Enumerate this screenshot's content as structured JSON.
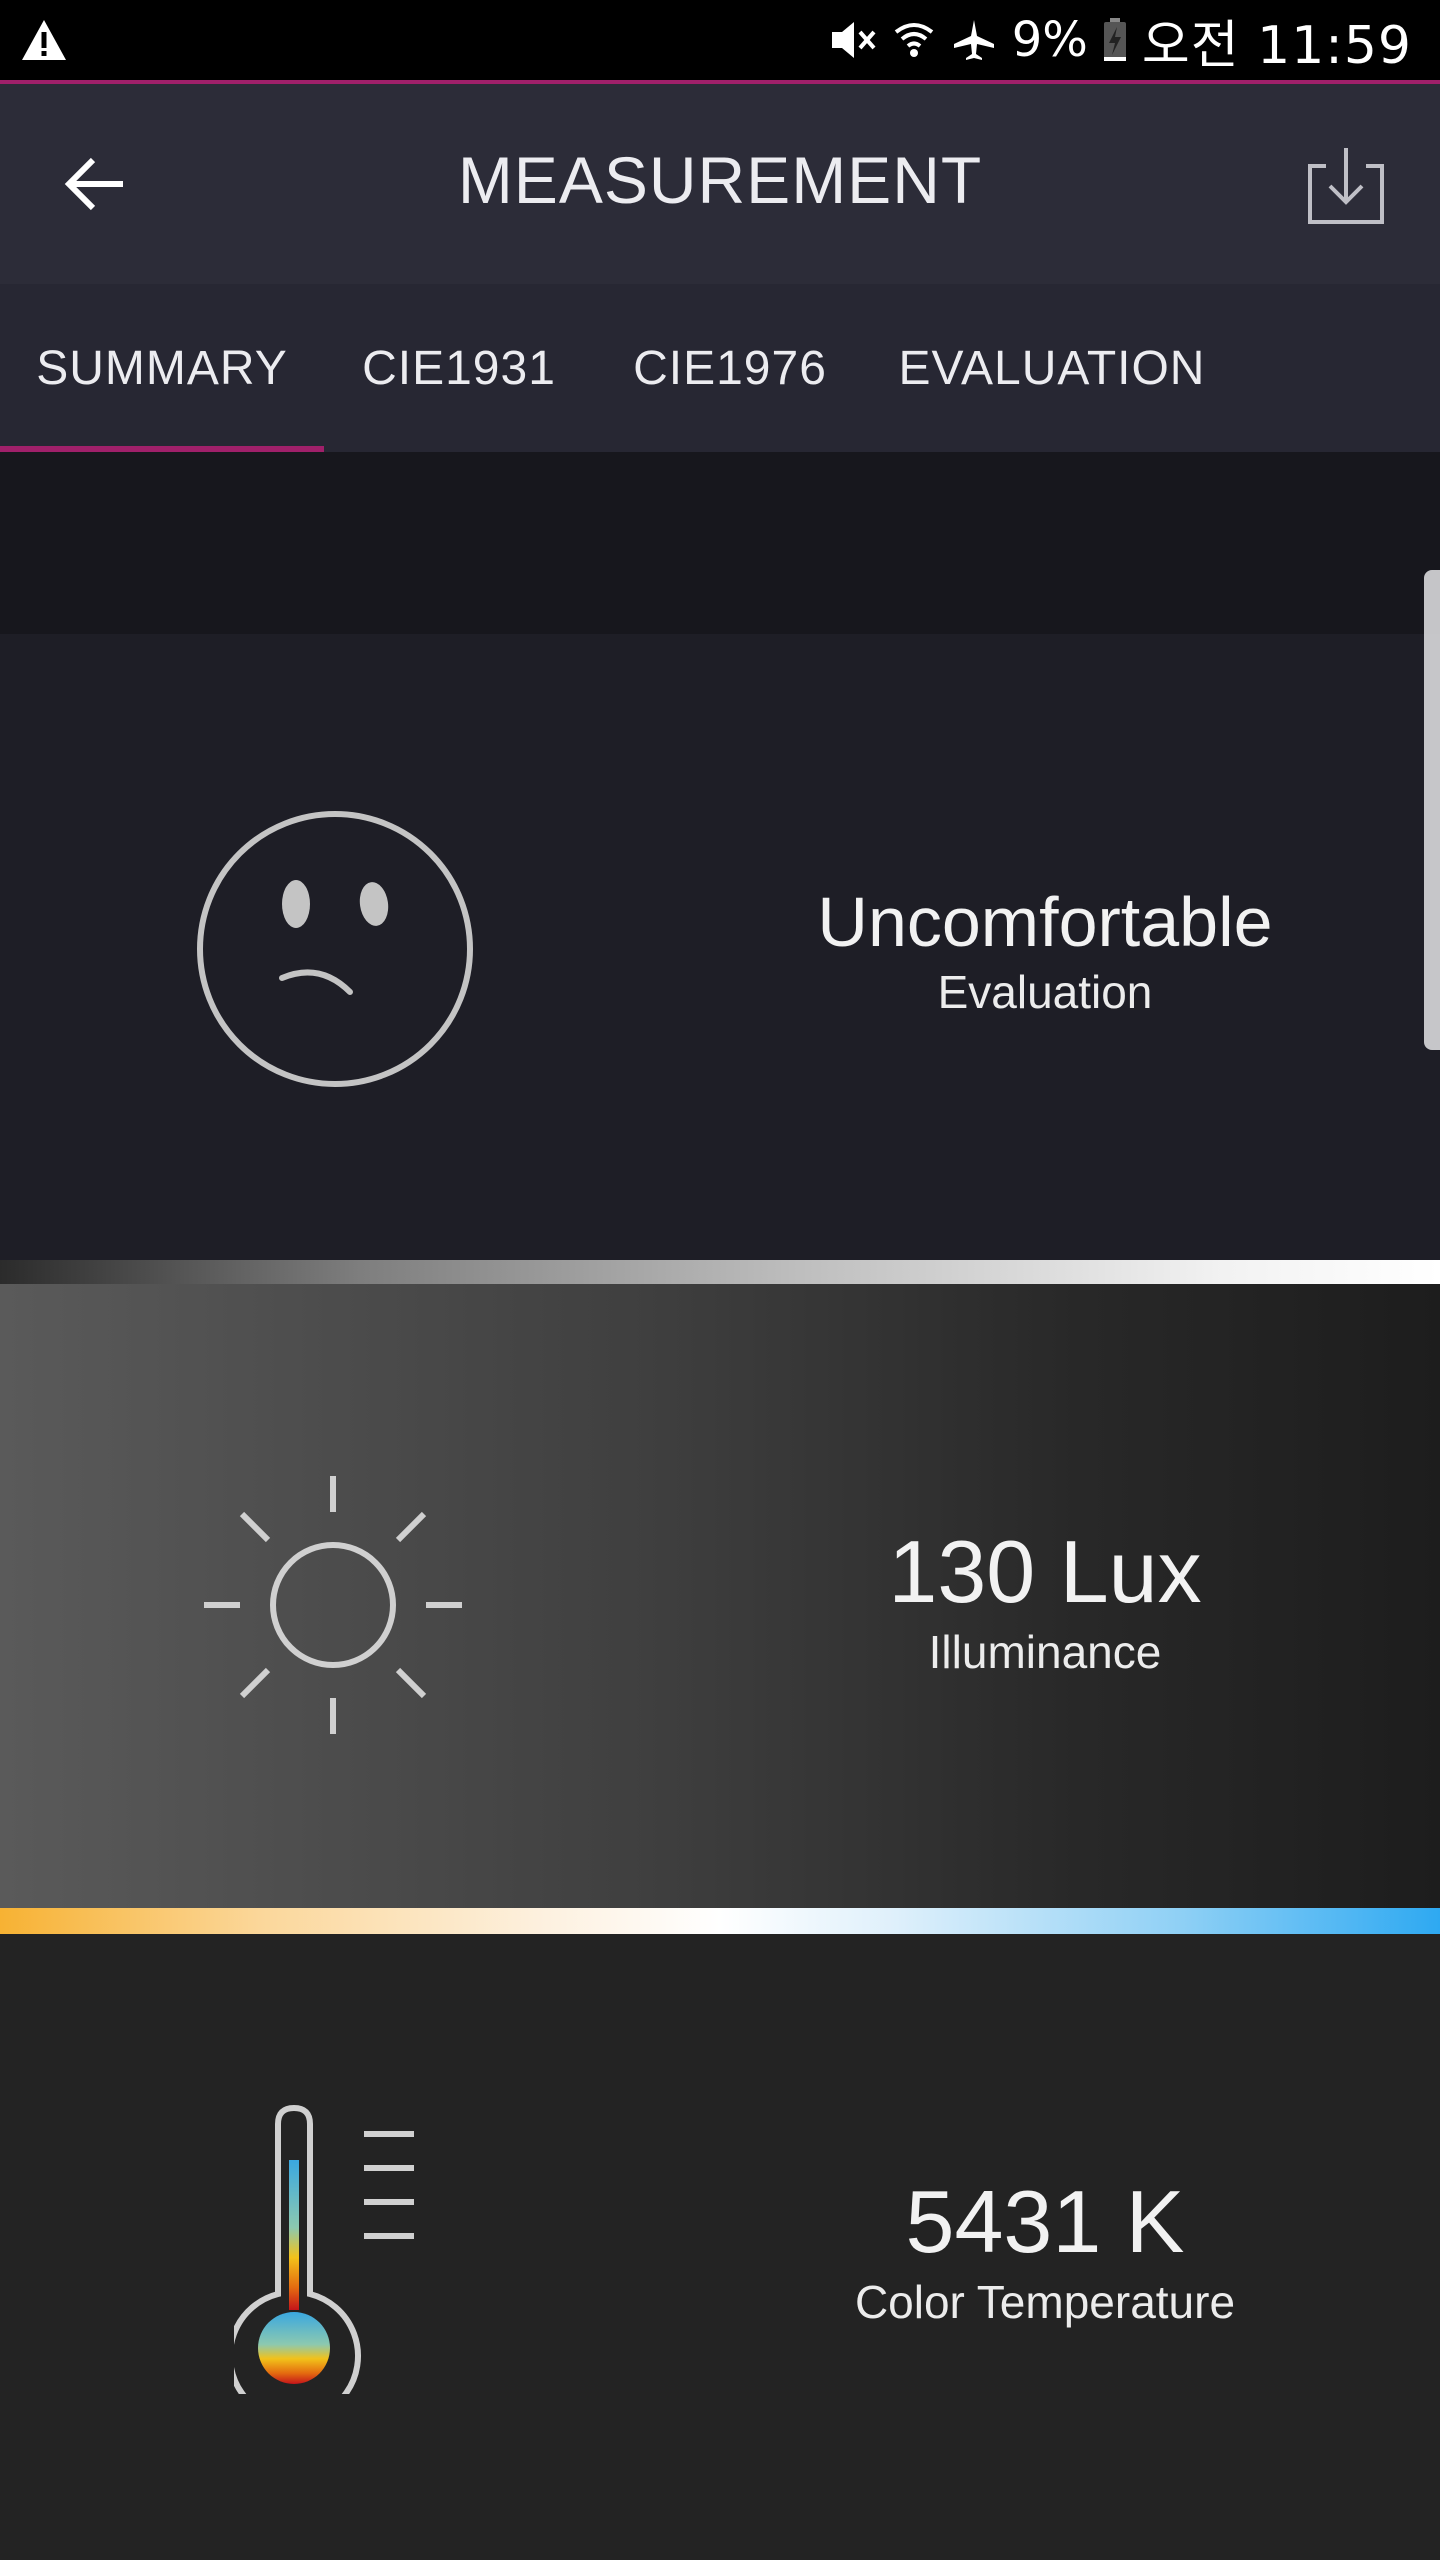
{
  "status_bar": {
    "battery_percent": "9%",
    "time": "오전 11:59",
    "icons": [
      "warning-icon",
      "mute-icon",
      "wifi-icon",
      "airplane-icon",
      "battery-charging-icon"
    ]
  },
  "app_bar": {
    "title": "MEASUREMENT",
    "back_icon": "arrow-left-icon",
    "download_icon": "download-icon"
  },
  "tabs": [
    {
      "label": "SUMMARY",
      "selected": true
    },
    {
      "label": "CIE1931",
      "selected": false
    },
    {
      "label": "CIE1976",
      "selected": false
    },
    {
      "label": "EVALUATION",
      "selected": false
    }
  ],
  "colors": {
    "accent": "#a0206a",
    "app_bar": "#2c2c38",
    "tab_bar": "#272733"
  },
  "cards": {
    "evaluation": {
      "value": "Uncomfortable",
      "label": "Evaluation",
      "icon": "sad-face-icon"
    },
    "illuminance": {
      "value": "130 Lux",
      "label": "Illuminance",
      "icon": "sun-icon"
    },
    "color_temperature": {
      "value": "5431 K",
      "label": "Color Temperature",
      "icon": "thermometer-icon"
    }
  }
}
